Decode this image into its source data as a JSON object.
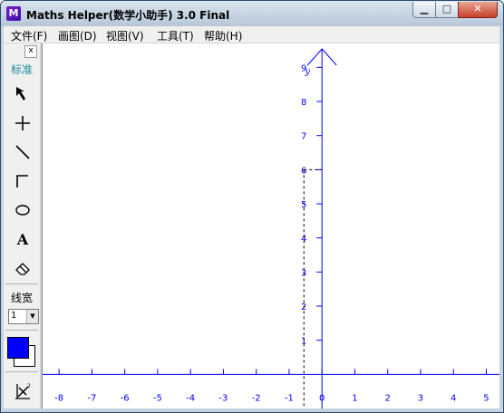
{
  "window": {
    "title": "Maths Helper(数学小助手) 3.0 Final",
    "app_icon": "M",
    "controls": {
      "minimize": "▁",
      "maximize": "□",
      "close": "✕"
    }
  },
  "menu": [
    {
      "label": "文件(F)"
    },
    {
      "label": "画图(D)"
    },
    {
      "label": "视图(V)"
    },
    {
      "label": "工具(T)"
    },
    {
      "label": "帮助(H)"
    }
  ],
  "toolbar": {
    "close": "x",
    "standard_label": "标准",
    "line_width_label": "线宽",
    "line_width_value": "1",
    "tools": [
      {
        "icon": "pointer-arrow-icon"
      },
      {
        "icon": "crosshair-point-icon"
      },
      {
        "icon": "line-icon"
      },
      {
        "icon": "right-angle-icon"
      },
      {
        "icon": "ellipse-icon"
      },
      {
        "icon": "text-a-icon"
      },
      {
        "icon": "eraser-icon"
      },
      {
        "icon": "function-plot-icon"
      }
    ],
    "colors": {
      "foreground": "#0000ff",
      "background": "#ffffff"
    }
  },
  "chart_data": {
    "type": "scatter",
    "ylabel": "y",
    "xlim": [
      -8.5,
      5.4
    ],
    "ylim": [
      -1,
      9.7
    ],
    "x_ticks": [
      -8,
      -7,
      -6,
      -5,
      -4,
      -3,
      -2,
      -1,
      0,
      1,
      2,
      3,
      4,
      5
    ],
    "x_tick_labels": [
      "-8",
      "-7",
      "-6",
      "-5",
      "-4",
      "-3",
      "-2",
      "-1",
      "0",
      "1",
      "2",
      "3",
      "4",
      "5"
    ],
    "y_ticks": [
      1,
      2,
      3,
      4,
      5,
      6,
      7,
      8,
      9
    ],
    "y_tick_labels": [
      "1",
      "2",
      "3",
      "4",
      "5",
      "6",
      "7",
      "8",
      "9"
    ],
    "axis_color": "#0000ff",
    "guide_point": {
      "x": -0.55,
      "y": 6.0
    }
  }
}
